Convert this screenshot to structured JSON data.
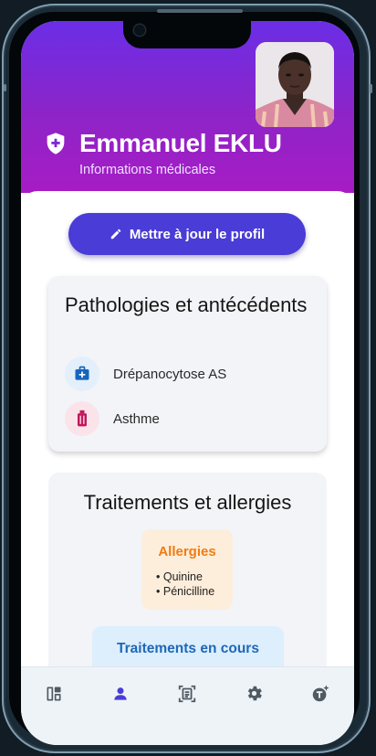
{
  "profile": {
    "name": "Emmanuel EKLU",
    "subtitle": "Informations médicales",
    "update_button": "Mettre à jour le profil"
  },
  "pathologies": {
    "title": "Pathologies et antécédents",
    "items": [
      {
        "label": "Drépanocytose AS",
        "icon": "medical-kit-icon",
        "color": "#1565c0",
        "bg": "#e3f0fb"
      },
      {
        "label": "Asthme",
        "icon": "inhaler-icon",
        "color": "#c2185b",
        "bg": "#fbe3ea"
      }
    ]
  },
  "treatments": {
    "title": "Traitements et allergies",
    "allergies": {
      "title": "Allergies",
      "items": [
        "Quinine",
        "Pénicilline"
      ]
    },
    "current": {
      "title": "Traitements en cours"
    }
  },
  "nav": {
    "items": [
      {
        "icon": "dashboard-icon",
        "active": false
      },
      {
        "icon": "person-icon",
        "active": true
      },
      {
        "icon": "document-scan-icon",
        "active": false
      },
      {
        "icon": "gear-icon",
        "active": false
      },
      {
        "icon": "ai-assistant-icon",
        "active": false
      }
    ]
  },
  "colors": {
    "header_gradient_top": "#6a2ee6",
    "header_gradient_bottom": "#a71cc4",
    "primary_button": "#4a3cd6",
    "allergy_accent": "#f07c12",
    "treatment_accent": "#1e68b8",
    "nav_active": "#4a3cd6"
  }
}
